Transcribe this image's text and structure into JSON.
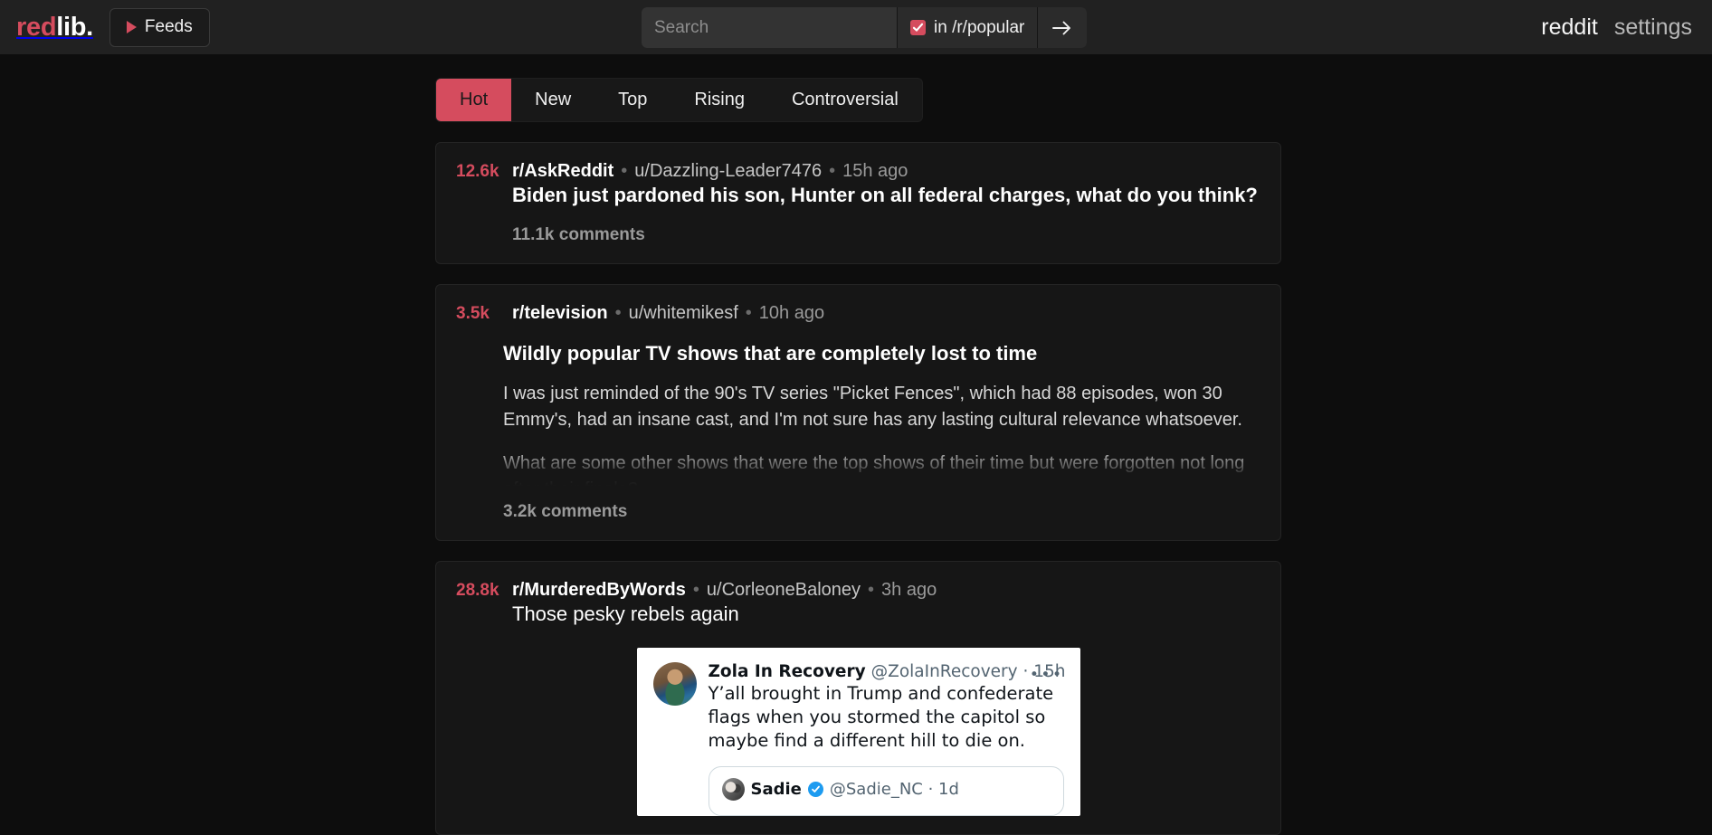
{
  "header": {
    "logo_red": "red",
    "logo_white": "lib.",
    "feeds_label": "Feeds",
    "feeds_icon": "play-triangle-icon",
    "search": {
      "placeholder": "Search",
      "value": "",
      "restrict_label": "in /r/popular",
      "restrict_checked": true,
      "submit_icon": "arrow-right-icon"
    },
    "links": [
      {
        "id": "reddit",
        "label": "reddit"
      },
      {
        "id": "settings",
        "label": "settings"
      }
    ]
  },
  "sort_tabs": {
    "active": "Hot",
    "items": [
      {
        "label": "Hot"
      },
      {
        "label": "New"
      },
      {
        "label": "Top"
      },
      {
        "label": "Rising"
      },
      {
        "label": "Controversial"
      }
    ]
  },
  "posts": [
    {
      "score": "12.6k",
      "subreddit": "r/AskReddit",
      "author": "u/Dazzling-Leader7476",
      "age": "15h ago",
      "title": "Biden just pardoned his son, Hunter on all federal charges, what do you think?",
      "title_bold": true,
      "comments": "11.1k comments"
    },
    {
      "score": "3.5k",
      "subreddit": "r/television",
      "author": "u/whitemikesf",
      "age": "10h ago",
      "title": "Wildly popular TV shows that are completely lost to time",
      "title_bold": true,
      "body_paragraphs": [
        "I was just reminded of the 90's TV series \"Picket Fences\", which had 88 episodes, won 30 Emmy's, had an insane cast, and I'm not sure has any lasting cultural relevance whatsoever.",
        "What are some other shows that were the top shows of their time but were forgotten not long after their finale?"
      ],
      "comments": "3.2k comments"
    },
    {
      "score": "28.8k",
      "subreddit": "r/MurderedByWords",
      "author": "u/CorleoneBaloney",
      "age": "3h ago",
      "title": "Those pesky rebels again",
      "title_bold": false,
      "tweet": {
        "name": "Zola In Recovery",
        "handle": "@ZolaInRecovery",
        "age": "15h",
        "more_icon": "ellipsis-icon",
        "text": "Y’all brought in Trump and confederate flags when you stormed the capitol so maybe find a different hill to die on.",
        "quoted": {
          "name": "Sadie",
          "verified": true,
          "handle": "@Sadie_NC",
          "age": "1d"
        }
      }
    }
  ],
  "colors": {
    "accent": "#d54c5e",
    "page_bg": "#0d0d0d",
    "header_bg": "#212121",
    "card_bg": "#161616"
  }
}
